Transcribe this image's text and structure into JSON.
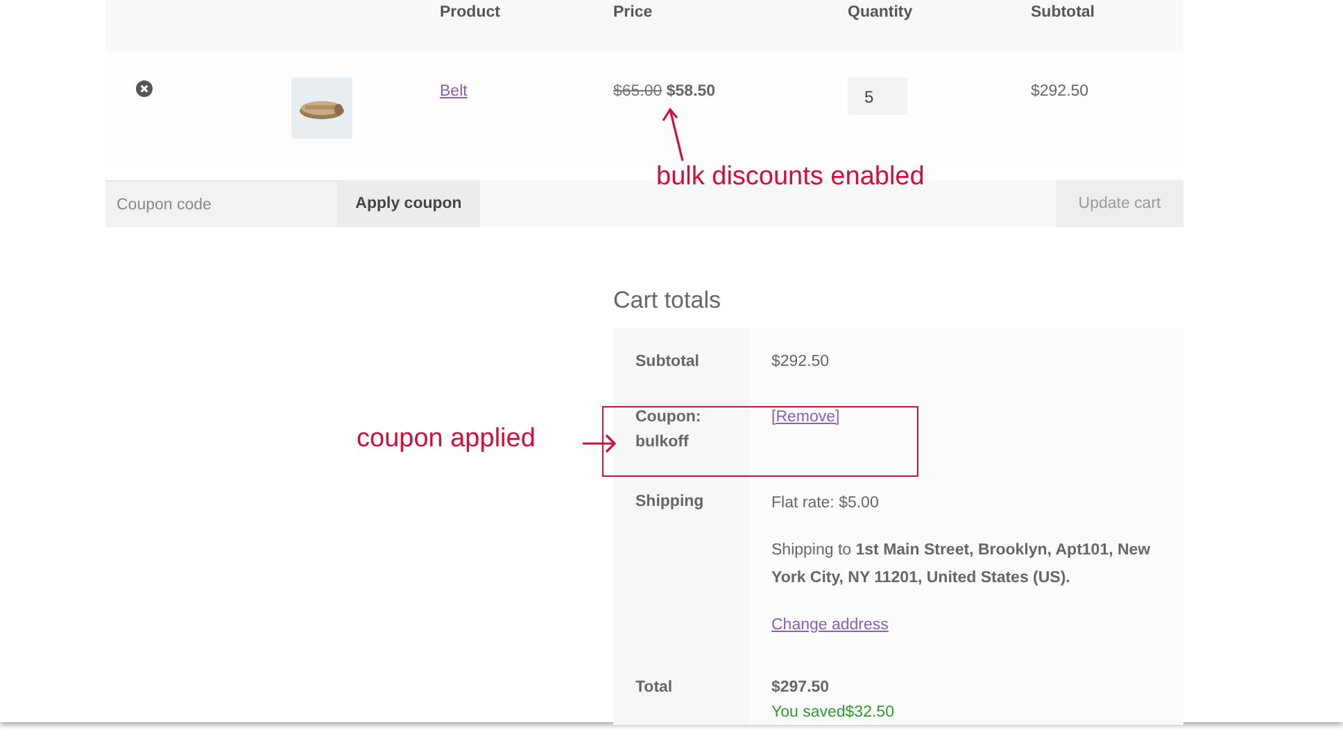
{
  "cart_table": {
    "columns": [
      "Product",
      "Price",
      "Quantity",
      "Subtotal"
    ],
    "rows": [
      {
        "product": "Belt",
        "regular_price": "$65.00",
        "sale_price": "$58.50",
        "quantity": "5",
        "subtotal": "$292.50"
      }
    ]
  },
  "coupon": {
    "placeholder": "Coupon code",
    "apply_button": "Apply coupon"
  },
  "update_button": {
    "label": "Update cart",
    "disabled": true
  },
  "cart_totals": {
    "title": "Cart totals",
    "rows": [
      {
        "kind": "subtotal",
        "label": "Subtotal",
        "value": "$292.50"
      },
      {
        "kind": "coupon",
        "label": "Coupon: bulkoff",
        "link": "[Remove]"
      },
      {
        "kind": "shipping",
        "label": "Shipping",
        "value": "Flat rate: $5.00",
        "note": "Shipping to **1st Main Street, Brooklyn, Apt101, New York City, NY 11201, United States (US).**",
        "link": "Change address"
      },
      {
        "kind": "total",
        "label": "Total",
        "value": "$297.50",
        "saved": "You saved$32.50"
      }
    ]
  },
  "annotations": [
    {
      "kind": "price",
      "text": "bulk discounts enabled"
    },
    {
      "kind": "coupon",
      "text": "coupon applied"
    }
  ]
}
